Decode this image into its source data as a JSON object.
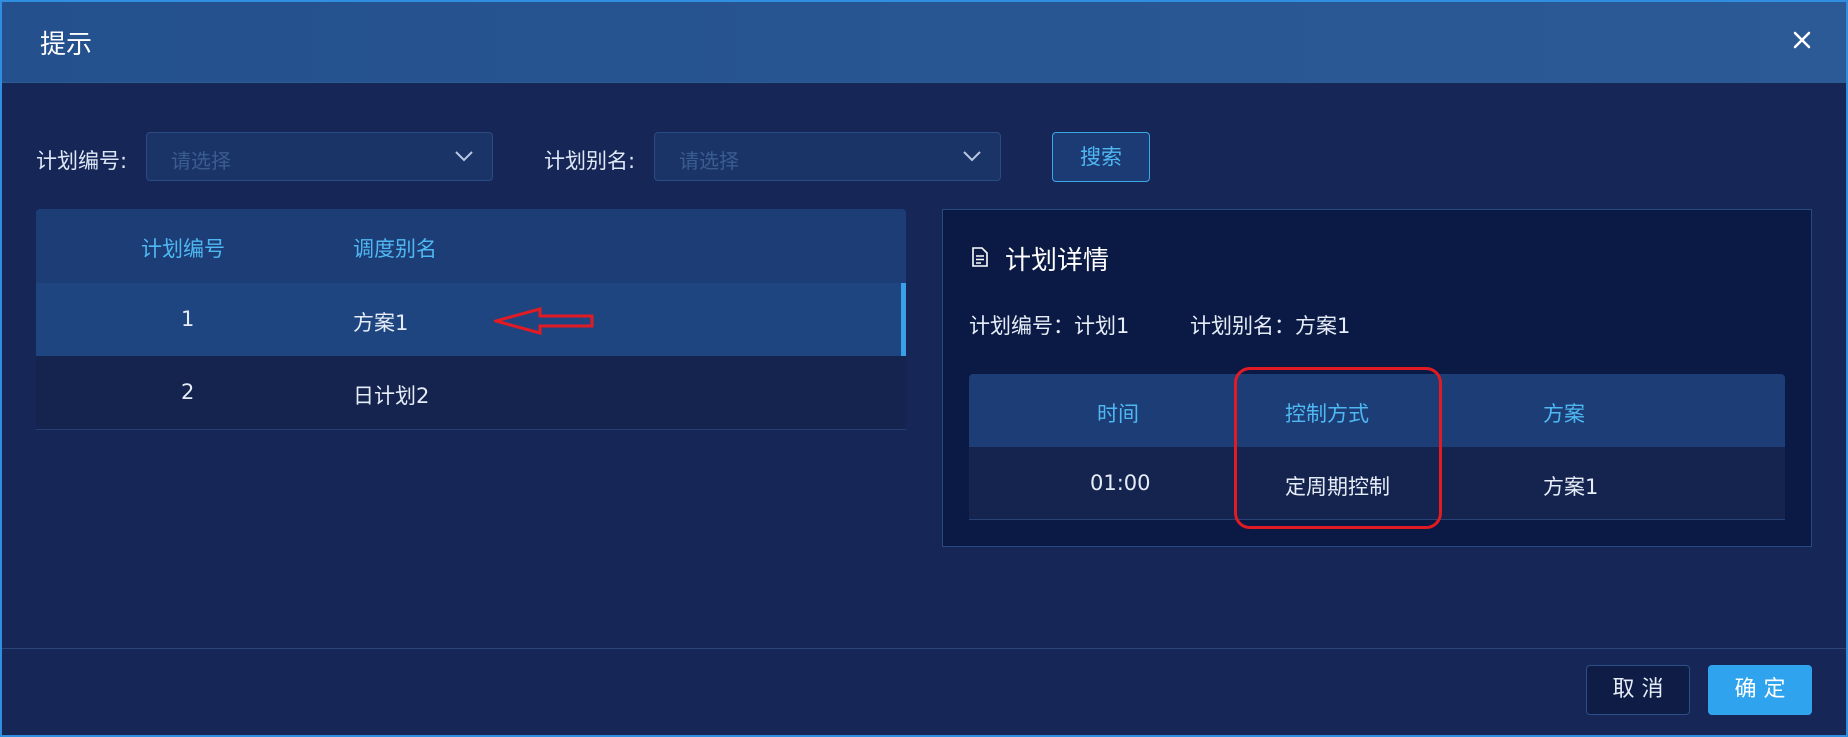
{
  "dialog": {
    "title": "提示"
  },
  "filters": {
    "plan_no_label": "计划编号:",
    "plan_no_placeholder": "请选择",
    "plan_alias_label": "计划别名:",
    "plan_alias_placeholder": "请选择",
    "search_label": "搜索"
  },
  "plan_table": {
    "columns": [
      "计划编号",
      "调度别名"
    ],
    "rows": [
      {
        "no": "1",
        "alias": "方案1",
        "selected": true
      },
      {
        "no": "2",
        "alias": "日计划2",
        "selected": false
      }
    ]
  },
  "detail": {
    "title": "计划详情",
    "plan_no_text": "计划编号：计划1",
    "plan_alias_text": "计划别名：方案1",
    "columns": [
      "时间",
      "控制方式",
      "方案"
    ],
    "rows": [
      {
        "time": "01:00",
        "control": "定周期控制",
        "plan": "方案1"
      }
    ]
  },
  "footer": {
    "cancel_label": "取 消",
    "ok_label": "确 定"
  },
  "colors": {
    "accent": "#2fa3ee",
    "annotation": "#e11b23",
    "header_text": "#4fb8f3"
  },
  "icons": [
    "close-icon",
    "chevron-down-icon",
    "document-icon",
    "arrow-left-annotation"
  ]
}
